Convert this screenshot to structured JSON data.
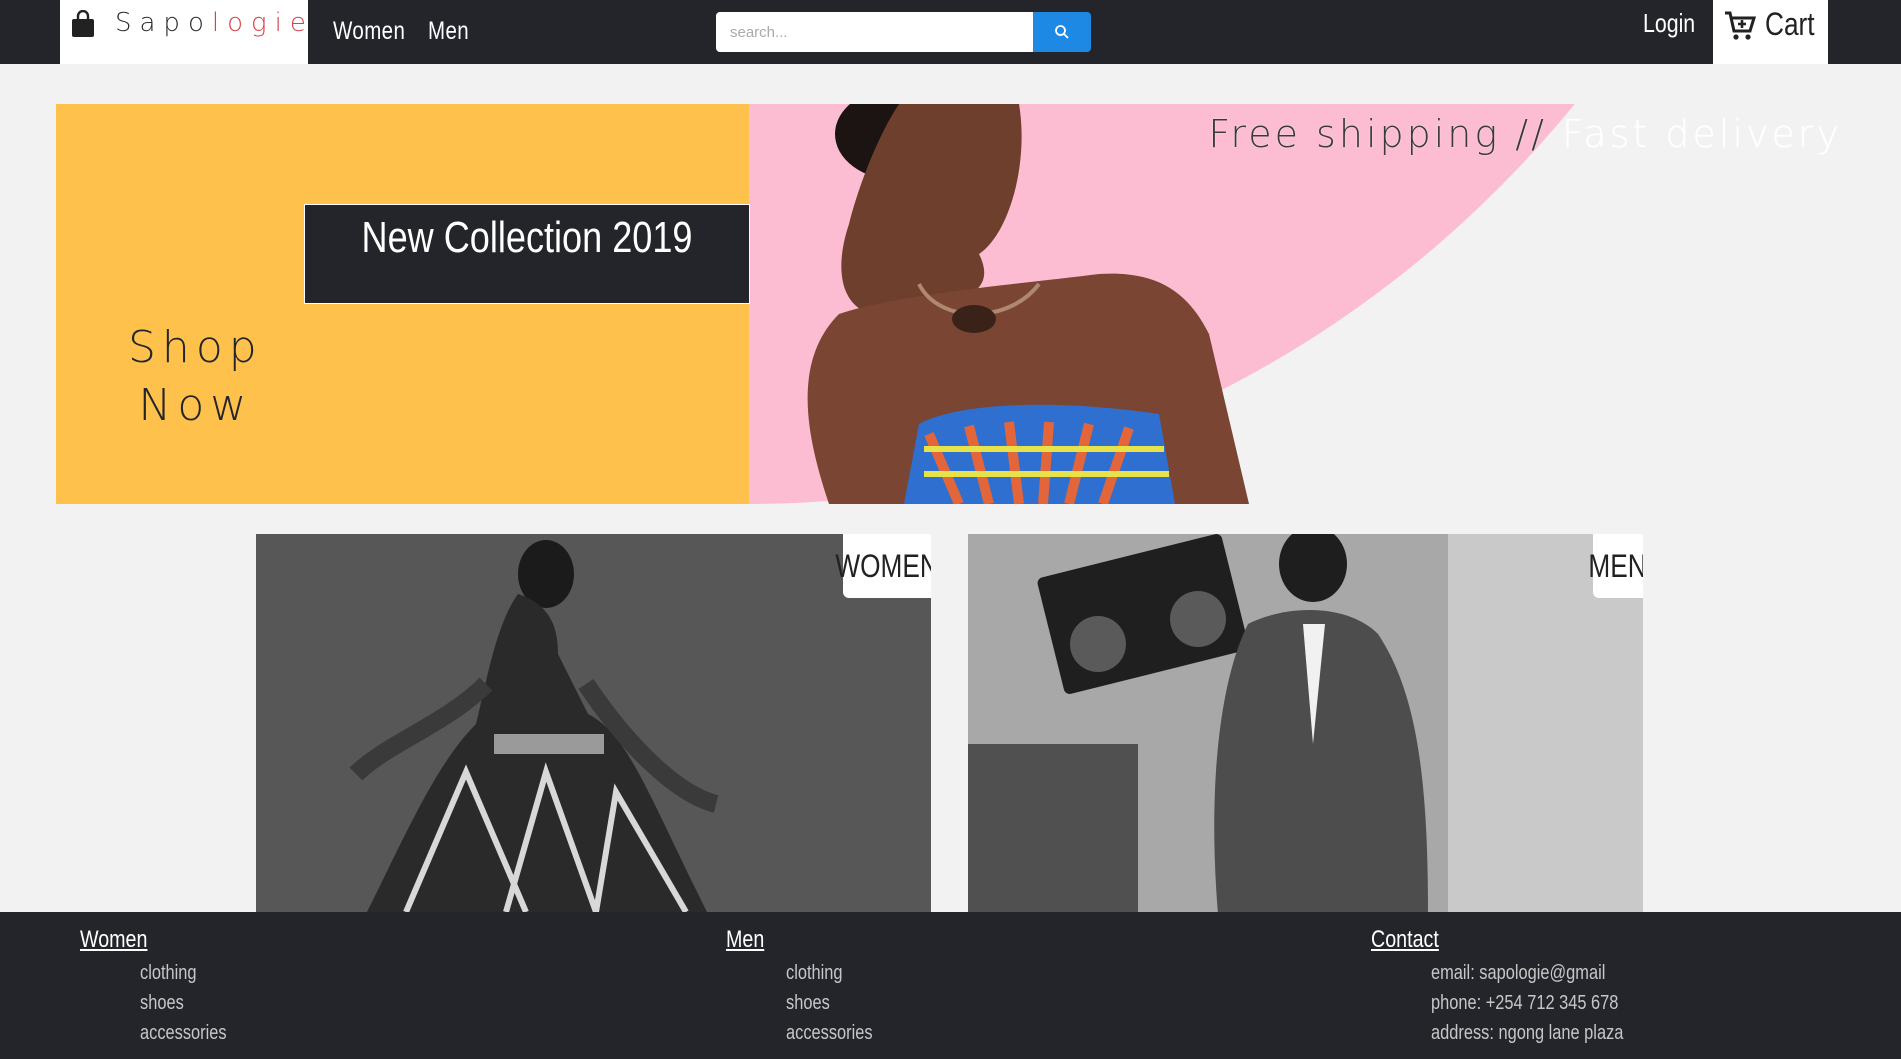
{
  "brand": {
    "name_part1": "Sapo",
    "name_part2": "logie"
  },
  "nav": {
    "women": "Women",
    "men": "Men",
    "login": "Login",
    "cart": "Cart"
  },
  "search": {
    "placeholder": "search..."
  },
  "banner": {
    "free_shipping": "Free shipping //",
    "fast_delivery": "Fast delivery",
    "collection": "New Collection 2019",
    "shop_line1": "Shop",
    "shop_line2": "Now"
  },
  "categories": [
    {
      "label": "WOMEN"
    },
    {
      "label": "MEN"
    }
  ],
  "footer": {
    "women": {
      "title": "Women",
      "items": [
        "clothing",
        "shoes",
        "accessories"
      ]
    },
    "men": {
      "title": "Men",
      "items": [
        "clothing",
        "shoes",
        "accessories"
      ]
    },
    "contact": {
      "title": "Contact",
      "items": [
        "email: sapologie@gmail",
        "phone: +254 712 345 678",
        "address: ngong lane plaza"
      ]
    }
  },
  "colors": {
    "dark": "#23252b",
    "accent_blue": "#1e88e5",
    "yellow": "#fec14b",
    "pink": "#fcbdd2",
    "logo_accent": "#d8404a"
  },
  "icons": [
    "shopping-bag-icon",
    "search-icon",
    "cart-icon"
  ]
}
